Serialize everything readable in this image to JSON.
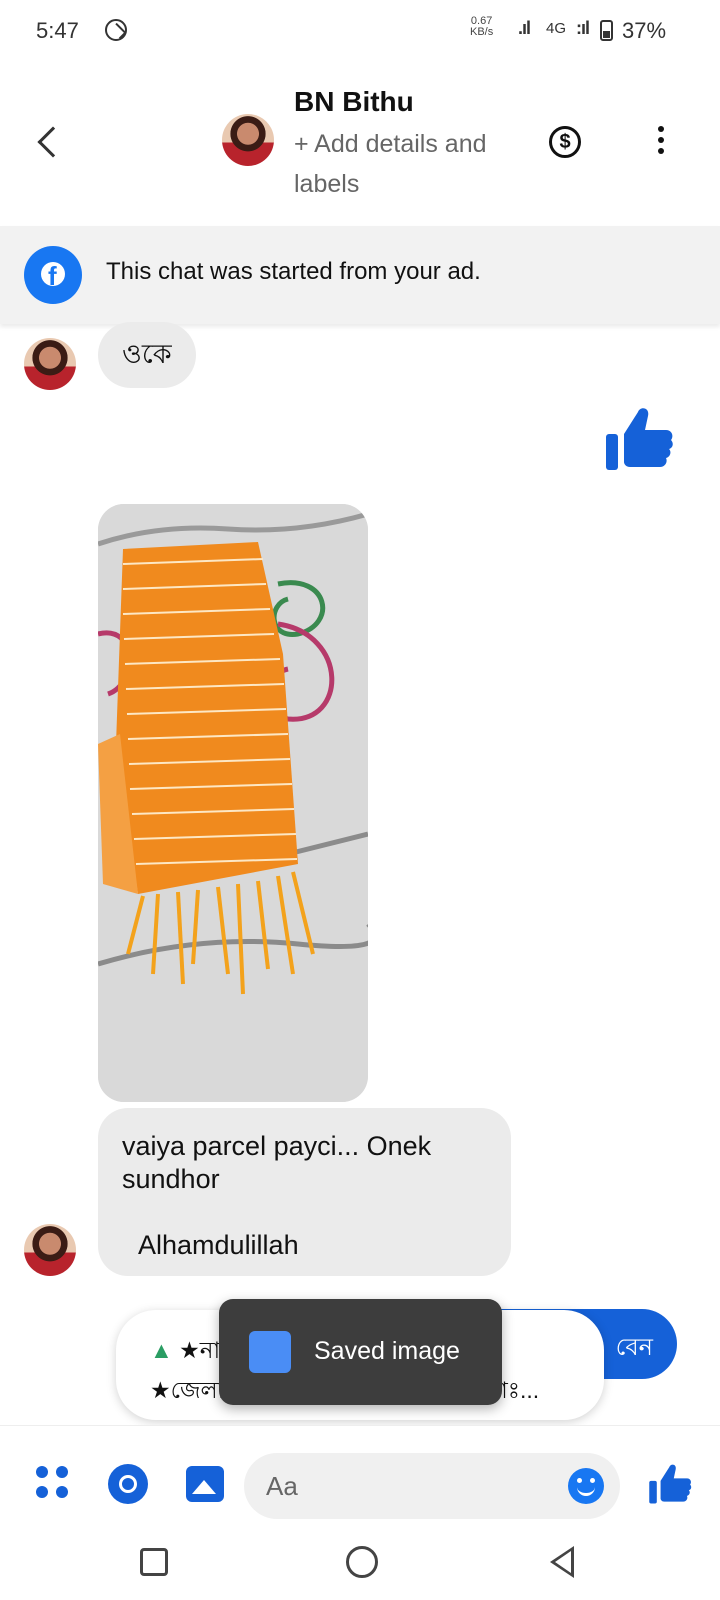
{
  "status_bar": {
    "time": "5:47",
    "network_speed_value": "0.67",
    "network_speed_unit": "KB/s",
    "signal_1": ".ıl",
    "network_type": "4G",
    "signal_2": ":ıl",
    "battery": "37%"
  },
  "header": {
    "contact_name": "BN Bithu",
    "add_details": "+ Add details and labels",
    "back_icon": "chevron-left-icon",
    "dollar_icon": "dollar-circle-icon",
    "more_icon": "more-vertical-icon"
  },
  "ad_banner": {
    "text": "This chat was started from your ad.",
    "icon": "facebook-icon"
  },
  "messages": {
    "okay_text": "ওকে",
    "like_icon": "thumbs-up-icon",
    "photo_icon": "image-orange-scarf",
    "received_line1": "vaiya parcel payci... Onek sundhor",
    "received_line2": "Alhamdulillah",
    "card_line1": "★নাম:...............?",
    "card_line2": "★জেলাঃ-..........?",
    "card_line3": "★থানাঃ...",
    "blue_bubble_text": "বেন"
  },
  "toast": {
    "label": "Saved image",
    "icon": "android-icon"
  },
  "composer": {
    "placeholder": "Aa",
    "apps_icon": "apps-icon",
    "camera_icon": "camera-icon",
    "gallery_icon": "gallery-icon",
    "emoji_icon": "emoji-icon",
    "like_icon": "thumbs-up-icon"
  },
  "navbar": {
    "recents_icon": "square-icon",
    "home_icon": "circle-icon",
    "back_icon": "triangle-back-icon"
  },
  "colors": {
    "accent": "#1561d8",
    "facebook_blue": "#1877f2",
    "bubble_gray": "#ebebeb",
    "scarf_orange": "#f08a1e"
  }
}
